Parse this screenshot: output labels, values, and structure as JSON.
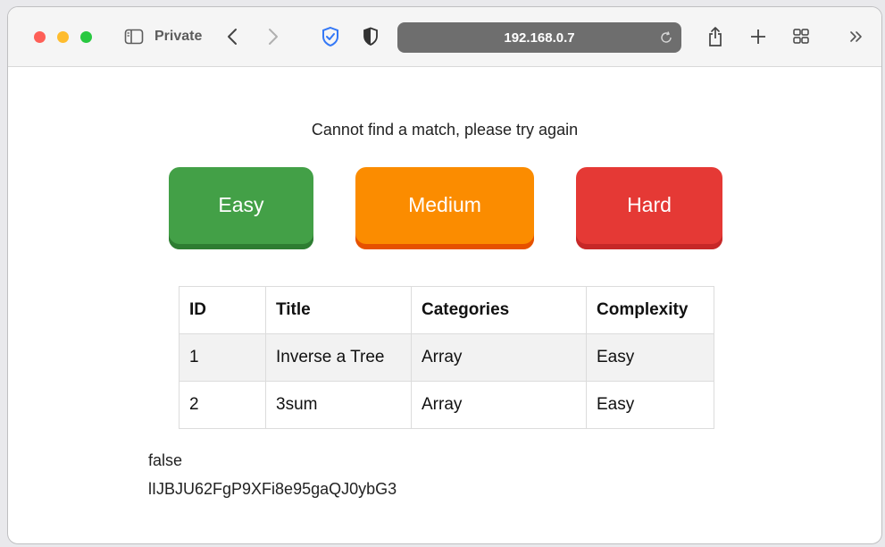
{
  "browser": {
    "private_label": "Private",
    "address": "192.168.0.7",
    "icons": [
      "sidebar-icon",
      "back-icon",
      "forward-icon",
      "shield-check-icon",
      "privacy-shield-icon",
      "reload-icon",
      "share-icon",
      "plus-icon",
      "tab-grid-icon",
      "double-chevron-icon"
    ]
  },
  "page": {
    "message": "Cannot find a match, please try again",
    "buttons": {
      "easy": "Easy",
      "medium": "Medium",
      "hard": "Hard"
    },
    "colors": {
      "easy": "#43a047",
      "medium": "#fb8c00",
      "hard": "#e53935"
    },
    "table": {
      "headers": [
        "ID",
        "Title",
        "Categories",
        "Complexity"
      ],
      "rows": [
        [
          "1",
          "Inverse a Tree",
          "Array",
          "Easy"
        ],
        [
          "2",
          "3sum",
          "Array",
          "Easy"
        ]
      ]
    },
    "status": "false",
    "token": "lIJBJU62FgP9XFi8e95gaQJ0ybG3"
  }
}
